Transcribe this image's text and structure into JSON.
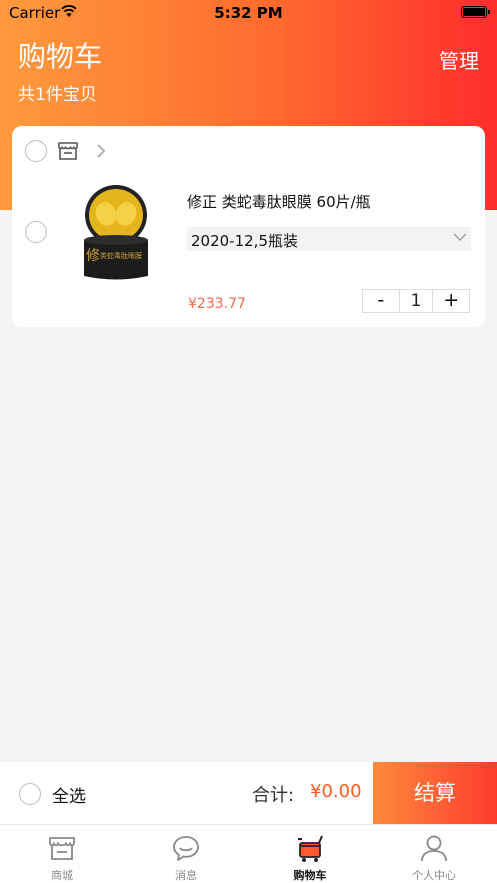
{
  "status_bar": {
    "carrier": "Carrier",
    "time": "5:32 PM"
  },
  "header": {
    "title": "购物车",
    "manage_label": "管理",
    "item_count": "共1件宝贝"
  },
  "cart": {
    "items": [
      {
        "title": "修正 类蛇毒肽眼膜 60片/瓶",
        "spec": "2020-12,5瓶装",
        "price": "¥233.77",
        "quantity": "1",
        "image_label": "类蛇毒肽眼膜"
      }
    ],
    "minus_label": "-",
    "plus_label": "+"
  },
  "bottom_bar": {
    "select_all_label": "全选",
    "total_label": "合计:",
    "total_value": "¥0.00",
    "checkout_label": "结算"
  },
  "tabs": [
    {
      "label": "商城",
      "icon": "store-icon"
    },
    {
      "label": "消息",
      "icon": "chat-bubble-icon"
    },
    {
      "label": "购物车",
      "icon": "cart-icon",
      "active": true
    },
    {
      "label": "个人中心",
      "icon": "user-icon"
    }
  ],
  "colors": {
    "header_start": "#ff9a3d",
    "header_end": "#ff2d2d",
    "price": "#f26a4b",
    "total": "#ff5a1f"
  }
}
